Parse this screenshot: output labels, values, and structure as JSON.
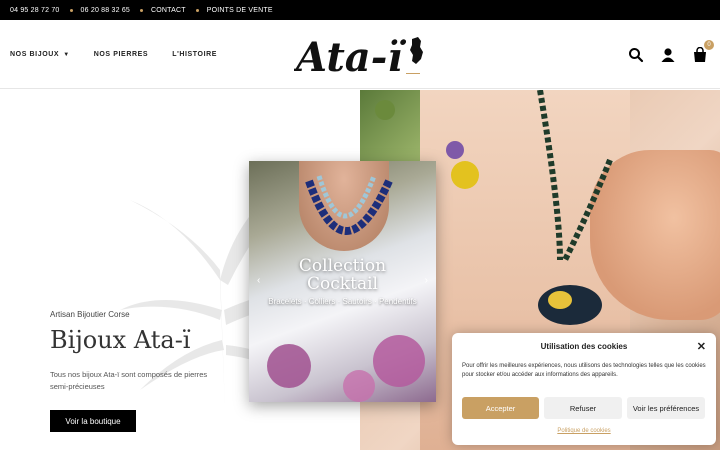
{
  "topbar": {
    "items": [
      "04 95 28 72 70",
      "06 20 88 32 65",
      "CONTACT",
      "POINTS DE VENTE"
    ]
  },
  "header": {
    "nav": [
      {
        "label": "NOS BIJOUX",
        "has_dropdown": true
      },
      {
        "label": "NOS PIERRES"
      },
      {
        "label": "L'HISTOIRE"
      }
    ],
    "logo_text": "Ata-ï",
    "icons": [
      "search-icon",
      "user-icon",
      "cart-icon"
    ],
    "cart_count": "0"
  },
  "hero": {
    "subtitle": "Artisan Bijoutier Corse",
    "title": "Bijoux Ata-ï",
    "description": "Tous nos bijoux Ata-ï sont composés de pierres semi-précieuses",
    "button": "Voir la boutique"
  },
  "card": {
    "title_line1": "Collection",
    "title_line2": "Cocktail",
    "subtitle": "Bracelets · Colliers · Sautoirs · Pendentifs"
  },
  "cookie": {
    "title": "Utilisation des cookies",
    "text": "Pour offrir les meilleures expériences, nous utilisons des technologies telles que les cookies pour stocker et/ou accéder aux informations des appareils.",
    "accept": "Accepter",
    "refuse": "Refuser",
    "prefs": "Voir les préférences",
    "policy": "Politique de cookies"
  },
  "colors": {
    "accent": "#c9a063",
    "topbar_bg": "#000000",
    "button_bg": "#000000"
  }
}
